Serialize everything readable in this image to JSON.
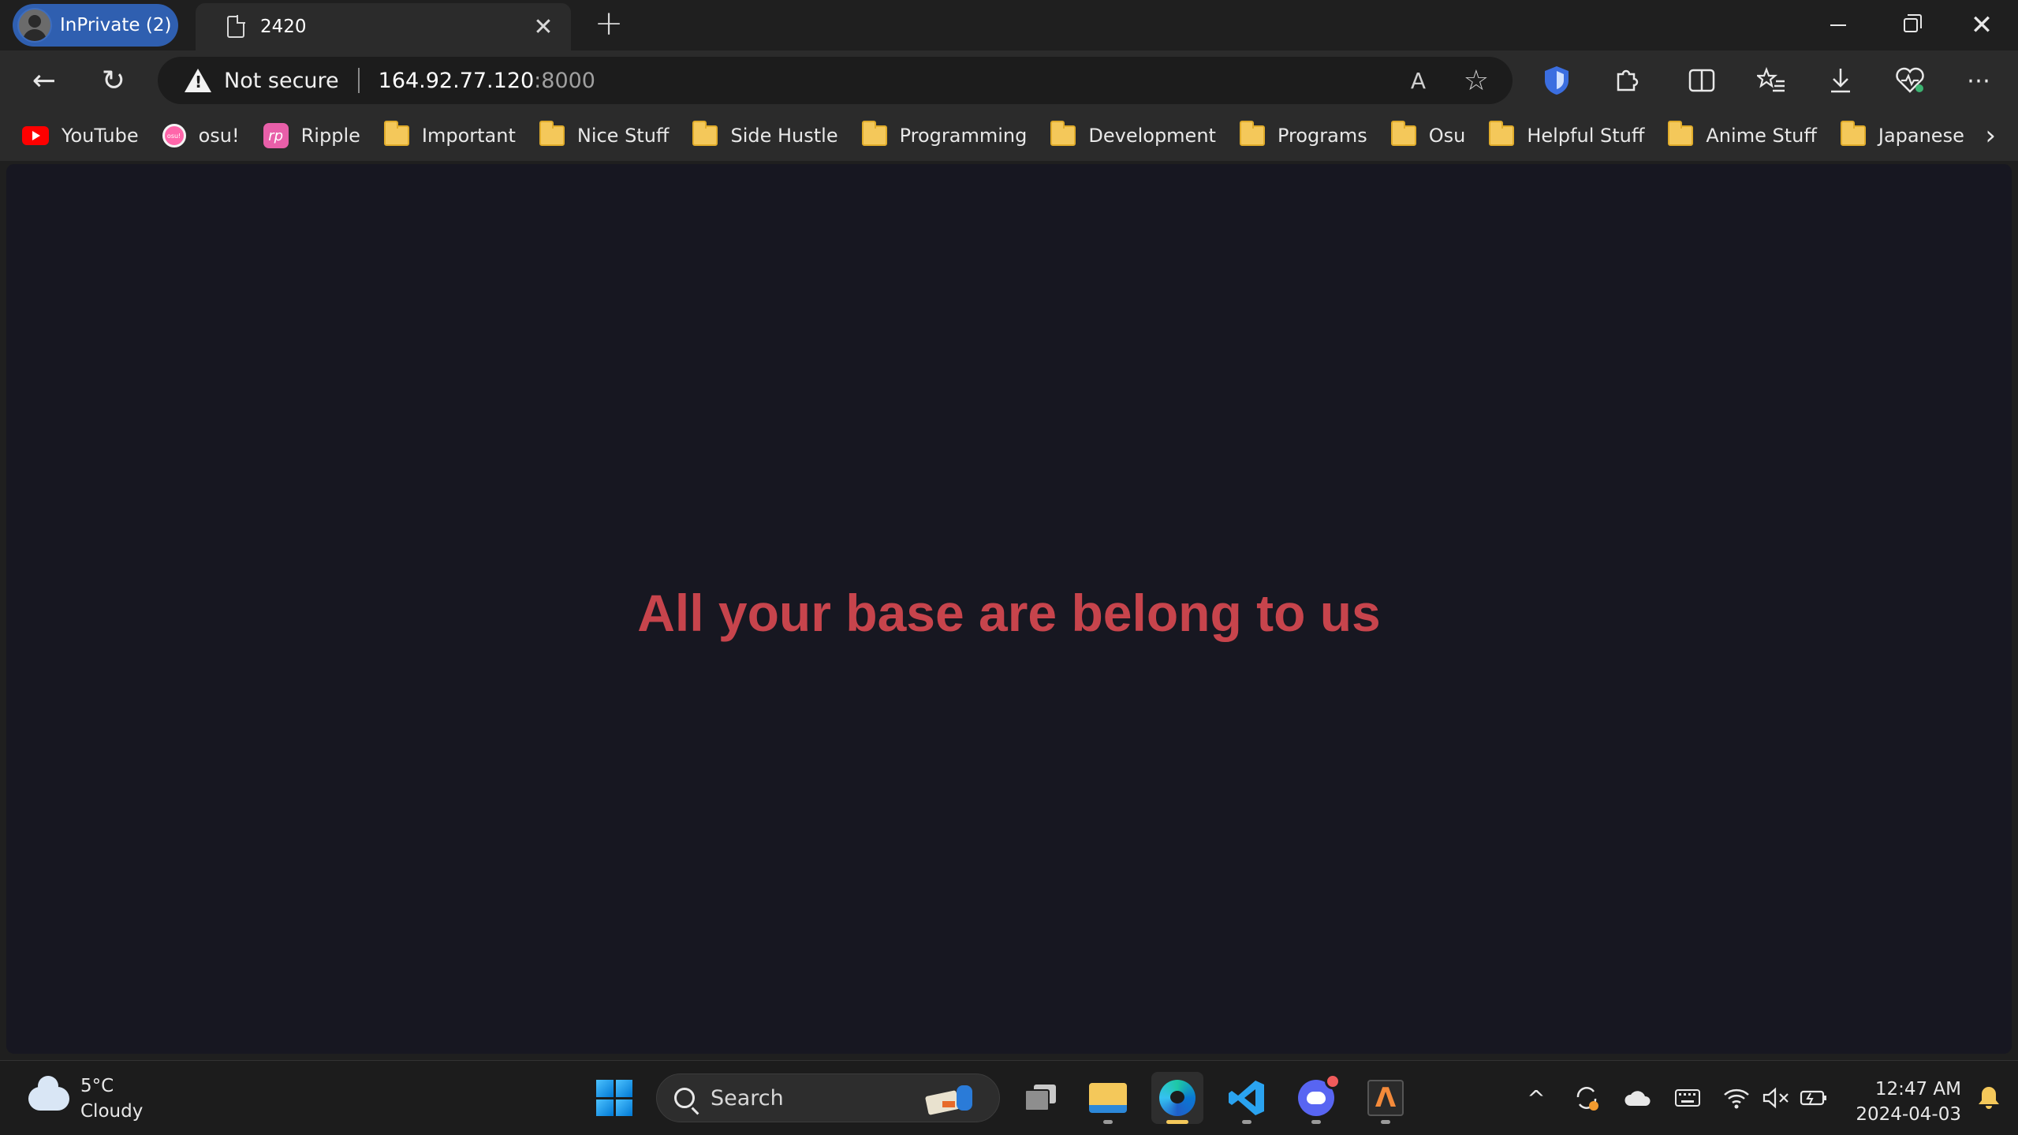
{
  "browser": {
    "profile_label": "InPrivate (2)",
    "tab_title": "2420",
    "tab_close": "✕",
    "new_tab": "+",
    "window_close": "✕"
  },
  "toolbar": {
    "back_icon": "←",
    "refresh_icon": "↻",
    "security_label": "Not secure",
    "url_host": "164.92.77.120",
    "url_port": ":8000",
    "read_aloud": "A",
    "favorite_star": "☆"
  },
  "bookmarks": [
    {
      "label": "YouTube",
      "icon": "youtube-icon"
    },
    {
      "label": "osu!",
      "icon": "osu-icon"
    },
    {
      "label": "Ripple",
      "icon": "ripple-icon"
    },
    {
      "label": "Important",
      "icon": "folder-icon"
    },
    {
      "label": "Nice Stuff",
      "icon": "folder-icon"
    },
    {
      "label": "Side Hustle",
      "icon": "folder-icon"
    },
    {
      "label": "Programming",
      "icon": "folder-icon"
    },
    {
      "label": "Development",
      "icon": "folder-icon"
    },
    {
      "label": "Programs",
      "icon": "folder-icon"
    },
    {
      "label": "Osu",
      "icon": "folder-icon"
    },
    {
      "label": "Helpful Stuff",
      "icon": "folder-icon"
    },
    {
      "label": "Anime Stuff",
      "icon": "folder-icon"
    },
    {
      "label": "Japanese",
      "icon": "folder-icon"
    }
  ],
  "page": {
    "headline": "All your base are belong to us",
    "headline_color": "#c7444c",
    "background_color": "#171721"
  },
  "taskbar": {
    "weather_temp": "5°C",
    "weather_desc": "Cloudy",
    "search_label": "Search",
    "clock_time": "12:47 AM",
    "clock_date": "2024-04-03"
  }
}
